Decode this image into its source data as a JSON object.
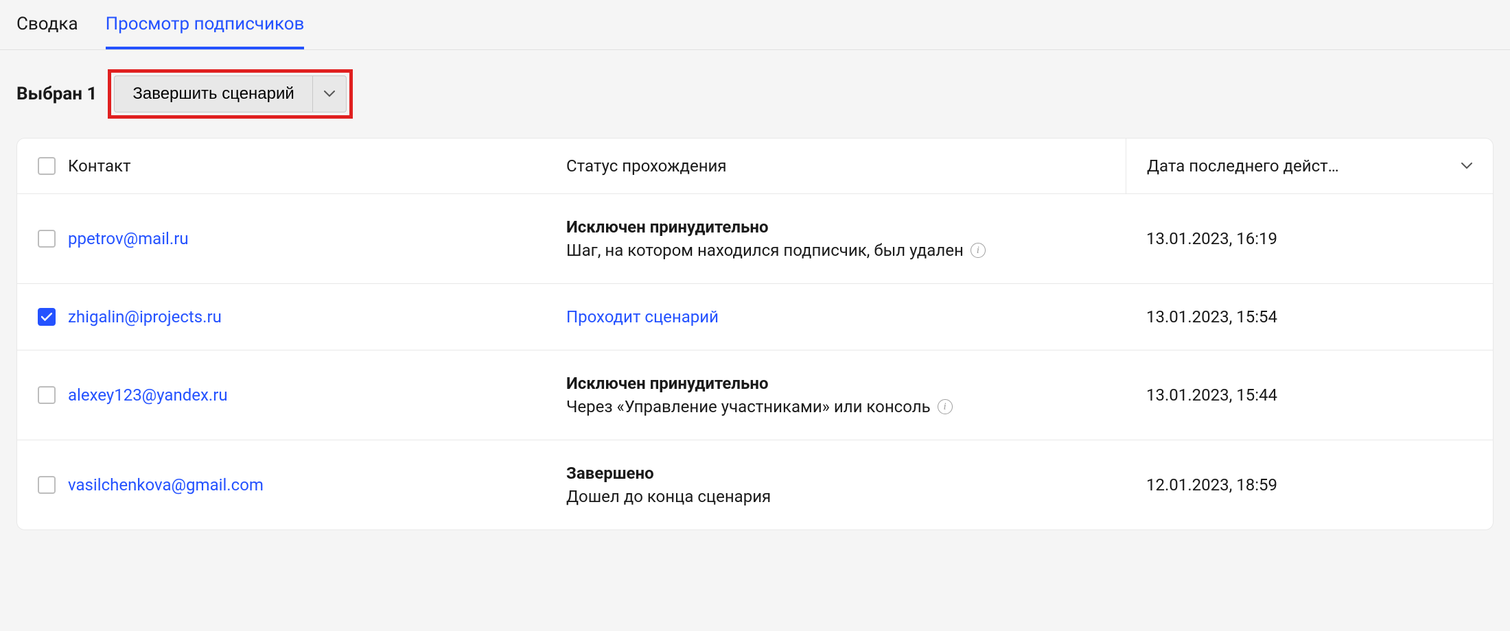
{
  "tabs": {
    "summary": "Сводка",
    "subscribers": "Просмотр подписчиков"
  },
  "action_bar": {
    "selected_label": "Выбран 1",
    "complete_scenario": "Завершить сценарий"
  },
  "table": {
    "headers": {
      "contact": "Контакт",
      "status": "Статус прохождения",
      "date": "Дата последнего дейст…"
    },
    "rows": [
      {
        "checked": false,
        "contact": "ppetrov@mail.ru",
        "status_title": "Исключен принудительно",
        "status_sub": "Шаг, на котором находился подписчик, был удален",
        "has_info": true,
        "status_link": false,
        "date": "13.01.2023, 16:19"
      },
      {
        "checked": true,
        "contact": "zhigalin@iprojects.ru",
        "status_title": "Проходит сценарий",
        "status_sub": "",
        "has_info": false,
        "status_link": true,
        "date": "13.01.2023, 15:54"
      },
      {
        "checked": false,
        "contact": "alexey123@yandex.ru",
        "status_title": "Исключен принудительно",
        "status_sub": "Через «Управление участниками» или консоль",
        "has_info": true,
        "status_link": false,
        "date": "13.01.2023, 15:44"
      },
      {
        "checked": false,
        "contact": "vasilchenkova@gmail.com",
        "status_title": "Завершено",
        "status_sub": "Дошел до конца сценария",
        "has_info": false,
        "status_link": false,
        "date": "12.01.2023, 18:59"
      }
    ]
  }
}
